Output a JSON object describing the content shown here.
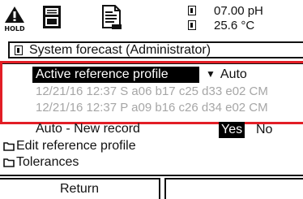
{
  "status": {
    "hold_label": "HOLD",
    "reading_1": "07.00 pH",
    "reading_2": "25.6 °C",
    "icons": [
      "warning-hold-icon",
      "memory-card-icon",
      "document-icon",
      "box-marker-icon"
    ]
  },
  "title": "System forecast (Administrator)",
  "list": {
    "selected_label": "Active reference profile",
    "selected_value": "Auto",
    "records": [
      "12/21/16 12:37  S  a06 b17 c25 d33 e02 CM",
      "12/21/16 12:37  P  a09 b16 c26 d34 e02 CM"
    ],
    "auto_new_label": "Auto - New record",
    "yes": "Yes",
    "no": "No",
    "folders": [
      "Edit reference profile",
      "Tolerances"
    ]
  },
  "softkeys": {
    "left": "Return",
    "right": ""
  },
  "colors": {
    "highlight_frame": "#e21e26",
    "record_text": "#a6a6a6",
    "background": "#ffffff"
  }
}
